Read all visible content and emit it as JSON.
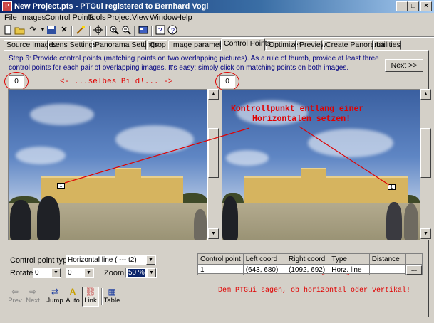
{
  "window": {
    "title": "New Project.pts - PTGui registered to Bernhard Vogl",
    "app_icon": "ptgui-app-icon",
    "controls": [
      "_",
      "□",
      "×"
    ]
  },
  "menu": [
    "File",
    "Images",
    "Control Points",
    "Tools",
    "Project",
    "View",
    "Window",
    "Help"
  ],
  "toolbar": {
    "icons": [
      "new-icon",
      "open-icon",
      "save-icon",
      "close-icon",
      "wand-icon",
      "zoom-in-icon",
      "zoom-out-icon",
      "panorama-editor-icon",
      "help-icon",
      "about-icon"
    ]
  },
  "tabs": [
    {
      "label": "Source Images"
    },
    {
      "label": "Lens Settings"
    },
    {
      "label": "Panorama Settings"
    },
    {
      "label": "Crop"
    },
    {
      "label": "Image parameters"
    },
    {
      "label": "Control Points",
      "active": true
    },
    {
      "label": "Optimizer"
    },
    {
      "label": "Preview"
    },
    {
      "label": "Create Panorama"
    },
    {
      "label": "Utilities"
    }
  ],
  "step": {
    "text": "Step 6: Provide control points (matching points on two overlapping pictures). As a rule of thumb, provide at least three control points for each pair of overlapping images. It's easy: simply click on matching points on both images.",
    "next_label": "Next >>"
  },
  "left_pane": {
    "image_number": "0",
    "cp_label": "1"
  },
  "right_pane": {
    "image_number": "0",
    "cp_label": "1"
  },
  "annotations": {
    "same_image": "<- ...selbes Bild!... ->",
    "horizon_line1": "Kontrollpunkt entlang einer",
    "horizon_line2": "Horizontalen setzen!",
    "tell_ptgui": "Dem PTGui sagen, ob horizontal oder vertikal!",
    "color": "#e00000"
  },
  "controls": {
    "cp_type_label": "Control point type:",
    "cp_type_value": "Horizontal line ( --- t2)",
    "rotate_label": "Rotate:",
    "rotate_value_1": "0",
    "rotate_value_2": "0",
    "zoom_label": "Zoom:",
    "zoom_value": "50 %"
  },
  "cp_table": {
    "headers": [
      "Control point",
      "Left coord",
      "Right coord",
      "Type",
      "Distance"
    ],
    "rows": [
      {
        "cp": "1",
        "left": "(643, 680)",
        "right": "(1092, 692)",
        "type": "Horz. line",
        "distance": "",
        "action": "..."
      }
    ]
  },
  "nav_buttons": [
    {
      "label": "Prev",
      "icon": "arrow-left-icon",
      "enabled": false
    },
    {
      "label": "Next",
      "icon": "arrow-right-icon",
      "enabled": false
    },
    {
      "label": "Jump",
      "icon": "jump-icon",
      "enabled": true
    },
    {
      "label": "Auto",
      "icon": "auto-icon",
      "enabled": true
    },
    {
      "label": "Link",
      "icon": "link-icon",
      "enabled": true,
      "pressed": true
    },
    {
      "label": "Table",
      "icon": "table-icon",
      "enabled": true
    }
  ]
}
